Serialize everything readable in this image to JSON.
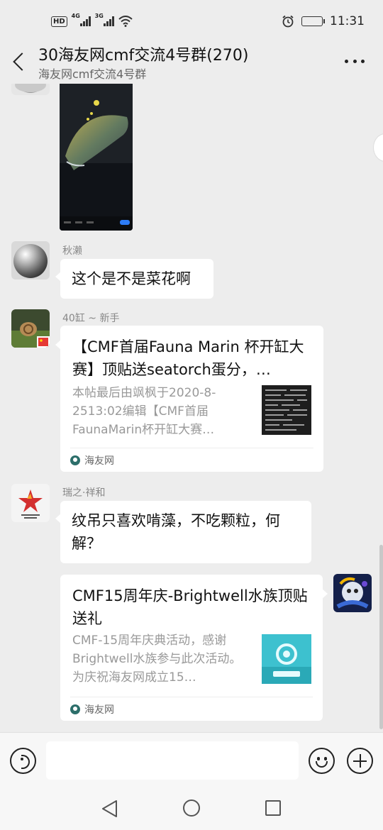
{
  "status_bar": {
    "hd": "HD",
    "sim1_network": "4G",
    "sim2_network": "3G",
    "time": "11:31",
    "battery_level": 0.4
  },
  "header": {
    "title": "30海友网cmf交流4号群(270)",
    "subtitle": "海友网cmf交流4号群",
    "back_icon": "chevron-left-icon",
    "more_icon": "more-dots-icon"
  },
  "messages": [
    {
      "type": "image",
      "content": "fish photo"
    },
    {
      "type": "text",
      "sender": "秋濑",
      "text": "这个是不是菜花啊"
    },
    {
      "type": "link",
      "sender": "40缸 ~ 新手",
      "title": "【CMF首届Fauna Marin 杯开缸大赛】顶贴送seatorch蛋分，…",
      "description": "本帖最后由飒枫于2020-8-2513:02编辑【CMF首届FaunaMarin杯开缸大赛…",
      "source": "海友网"
    },
    {
      "type": "text",
      "sender": "瑞之·祥和",
      "text": "纹吊只喜欢啃藻，不吃颗粒，何解？"
    },
    {
      "type": "link",
      "sender": "",
      "title": "CMF15周年庆-Brightwell水族顶贴送礼",
      "description": "CMF-15周年庆典活动，感谢Brightwell水族参与此次活动。为庆祝海友网成立15…",
      "source": "海友网"
    }
  ],
  "input_bar": {
    "voice_icon": "voice-icon",
    "input_value": "",
    "emoji_icon": "emoji-icon",
    "plus_icon": "plus-icon"
  },
  "nav_bar": {
    "back_icon": "nav-back-icon",
    "home_icon": "nav-home-icon",
    "recent_icon": "nav-recent-icon"
  }
}
